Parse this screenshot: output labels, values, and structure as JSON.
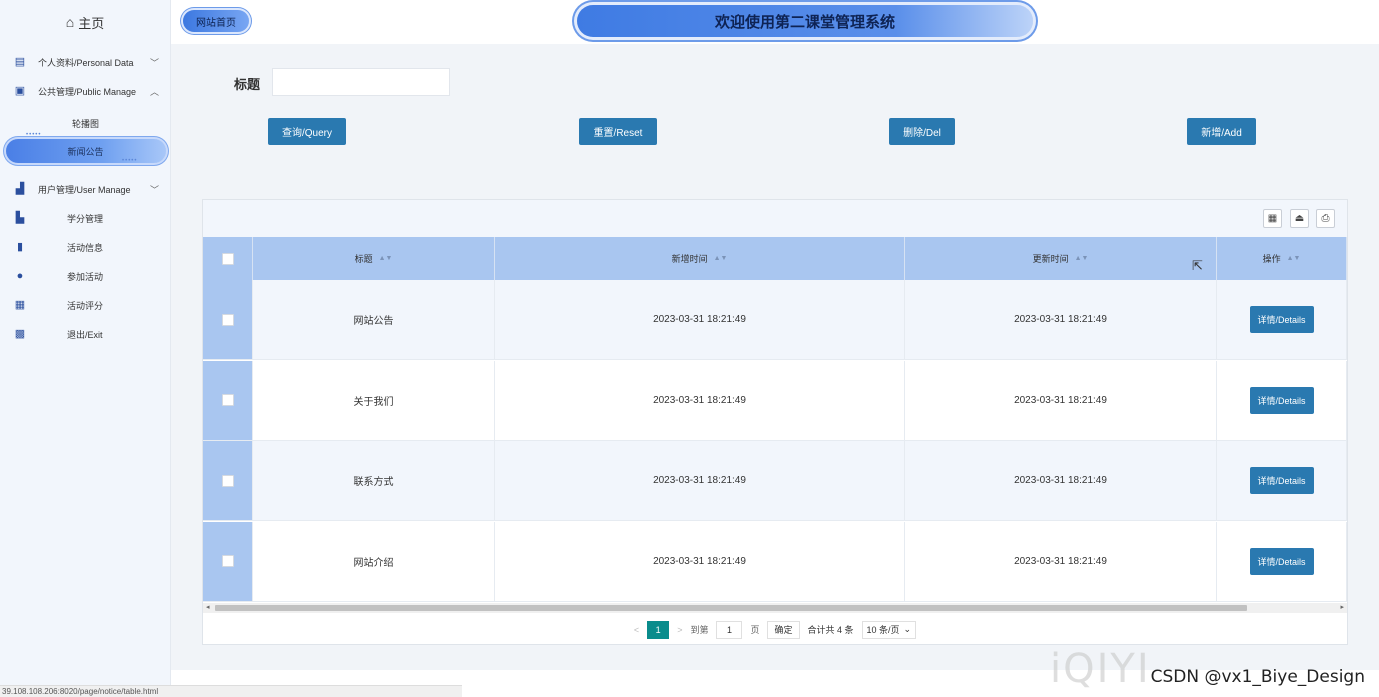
{
  "sidebar": {
    "home_label": "主页",
    "items": [
      {
        "label": "个人资料/Personal Data",
        "icon": "doc-icon"
      },
      {
        "label": "公共管理/Public Manage",
        "icon": "clipboard-icon"
      },
      {
        "label": "用户管理/User Manage",
        "icon": "users-chart-icon"
      },
      {
        "label": "学分管理",
        "icon": "chart-icon"
      },
      {
        "label": "活动信息",
        "icon": "bookmark-icon"
      },
      {
        "label": "参加活动",
        "icon": "person-icon"
      },
      {
        "label": "活动评分",
        "icon": "calendar-icon"
      },
      {
        "label": "退出/Exit",
        "icon": "calendar-check-icon"
      }
    ],
    "sub_items": [
      {
        "label": "轮播图"
      },
      {
        "label": "新闻公告"
      }
    ]
  },
  "header": {
    "home_button": "网站首页",
    "title": "欢迎使用第二课堂管理系统"
  },
  "search": {
    "label": "标题",
    "value": "",
    "placeholder": ""
  },
  "actions": {
    "query": "查询/Query",
    "reset": "重置/Reset",
    "delete": "删除/Del",
    "add": "新增/Add"
  },
  "table": {
    "columns": [
      "标题",
      "新增时间",
      "更新时间",
      "操作"
    ],
    "rows": [
      {
        "title": "网站公告",
        "created": "2023-03-31 18:21:49",
        "updated": "2023-03-31 18:21:49",
        "action": "详情/Details"
      },
      {
        "title": "关于我们",
        "created": "2023-03-31 18:21:49",
        "updated": "2023-03-31 18:21:49",
        "action": "详情/Details"
      },
      {
        "title": "联系方式",
        "created": "2023-03-31 18:21:49",
        "updated": "2023-03-31 18:21:49",
        "action": "详情/Details"
      },
      {
        "title": "网站介绍",
        "created": "2023-03-31 18:21:49",
        "updated": "2023-03-31 18:21:49",
        "action": "详情/Details"
      }
    ]
  },
  "pager": {
    "current_page": "1",
    "goto_label": "到第",
    "goto_value": "1",
    "page_unit": "页",
    "confirm": "确定",
    "total": "合计共 4 条",
    "page_size": "10 条/页"
  },
  "status_bar": {
    "url": "39.108.108.206:8020/page/notice/table.html"
  },
  "watermark": {
    "text": "CSDN @vx1_Biye_Design",
    "logo": "iQIYI"
  },
  "colors": {
    "accent": "#2a79b0",
    "header_row": "#a9c6f0",
    "pager_active": "#0a8c8c"
  }
}
